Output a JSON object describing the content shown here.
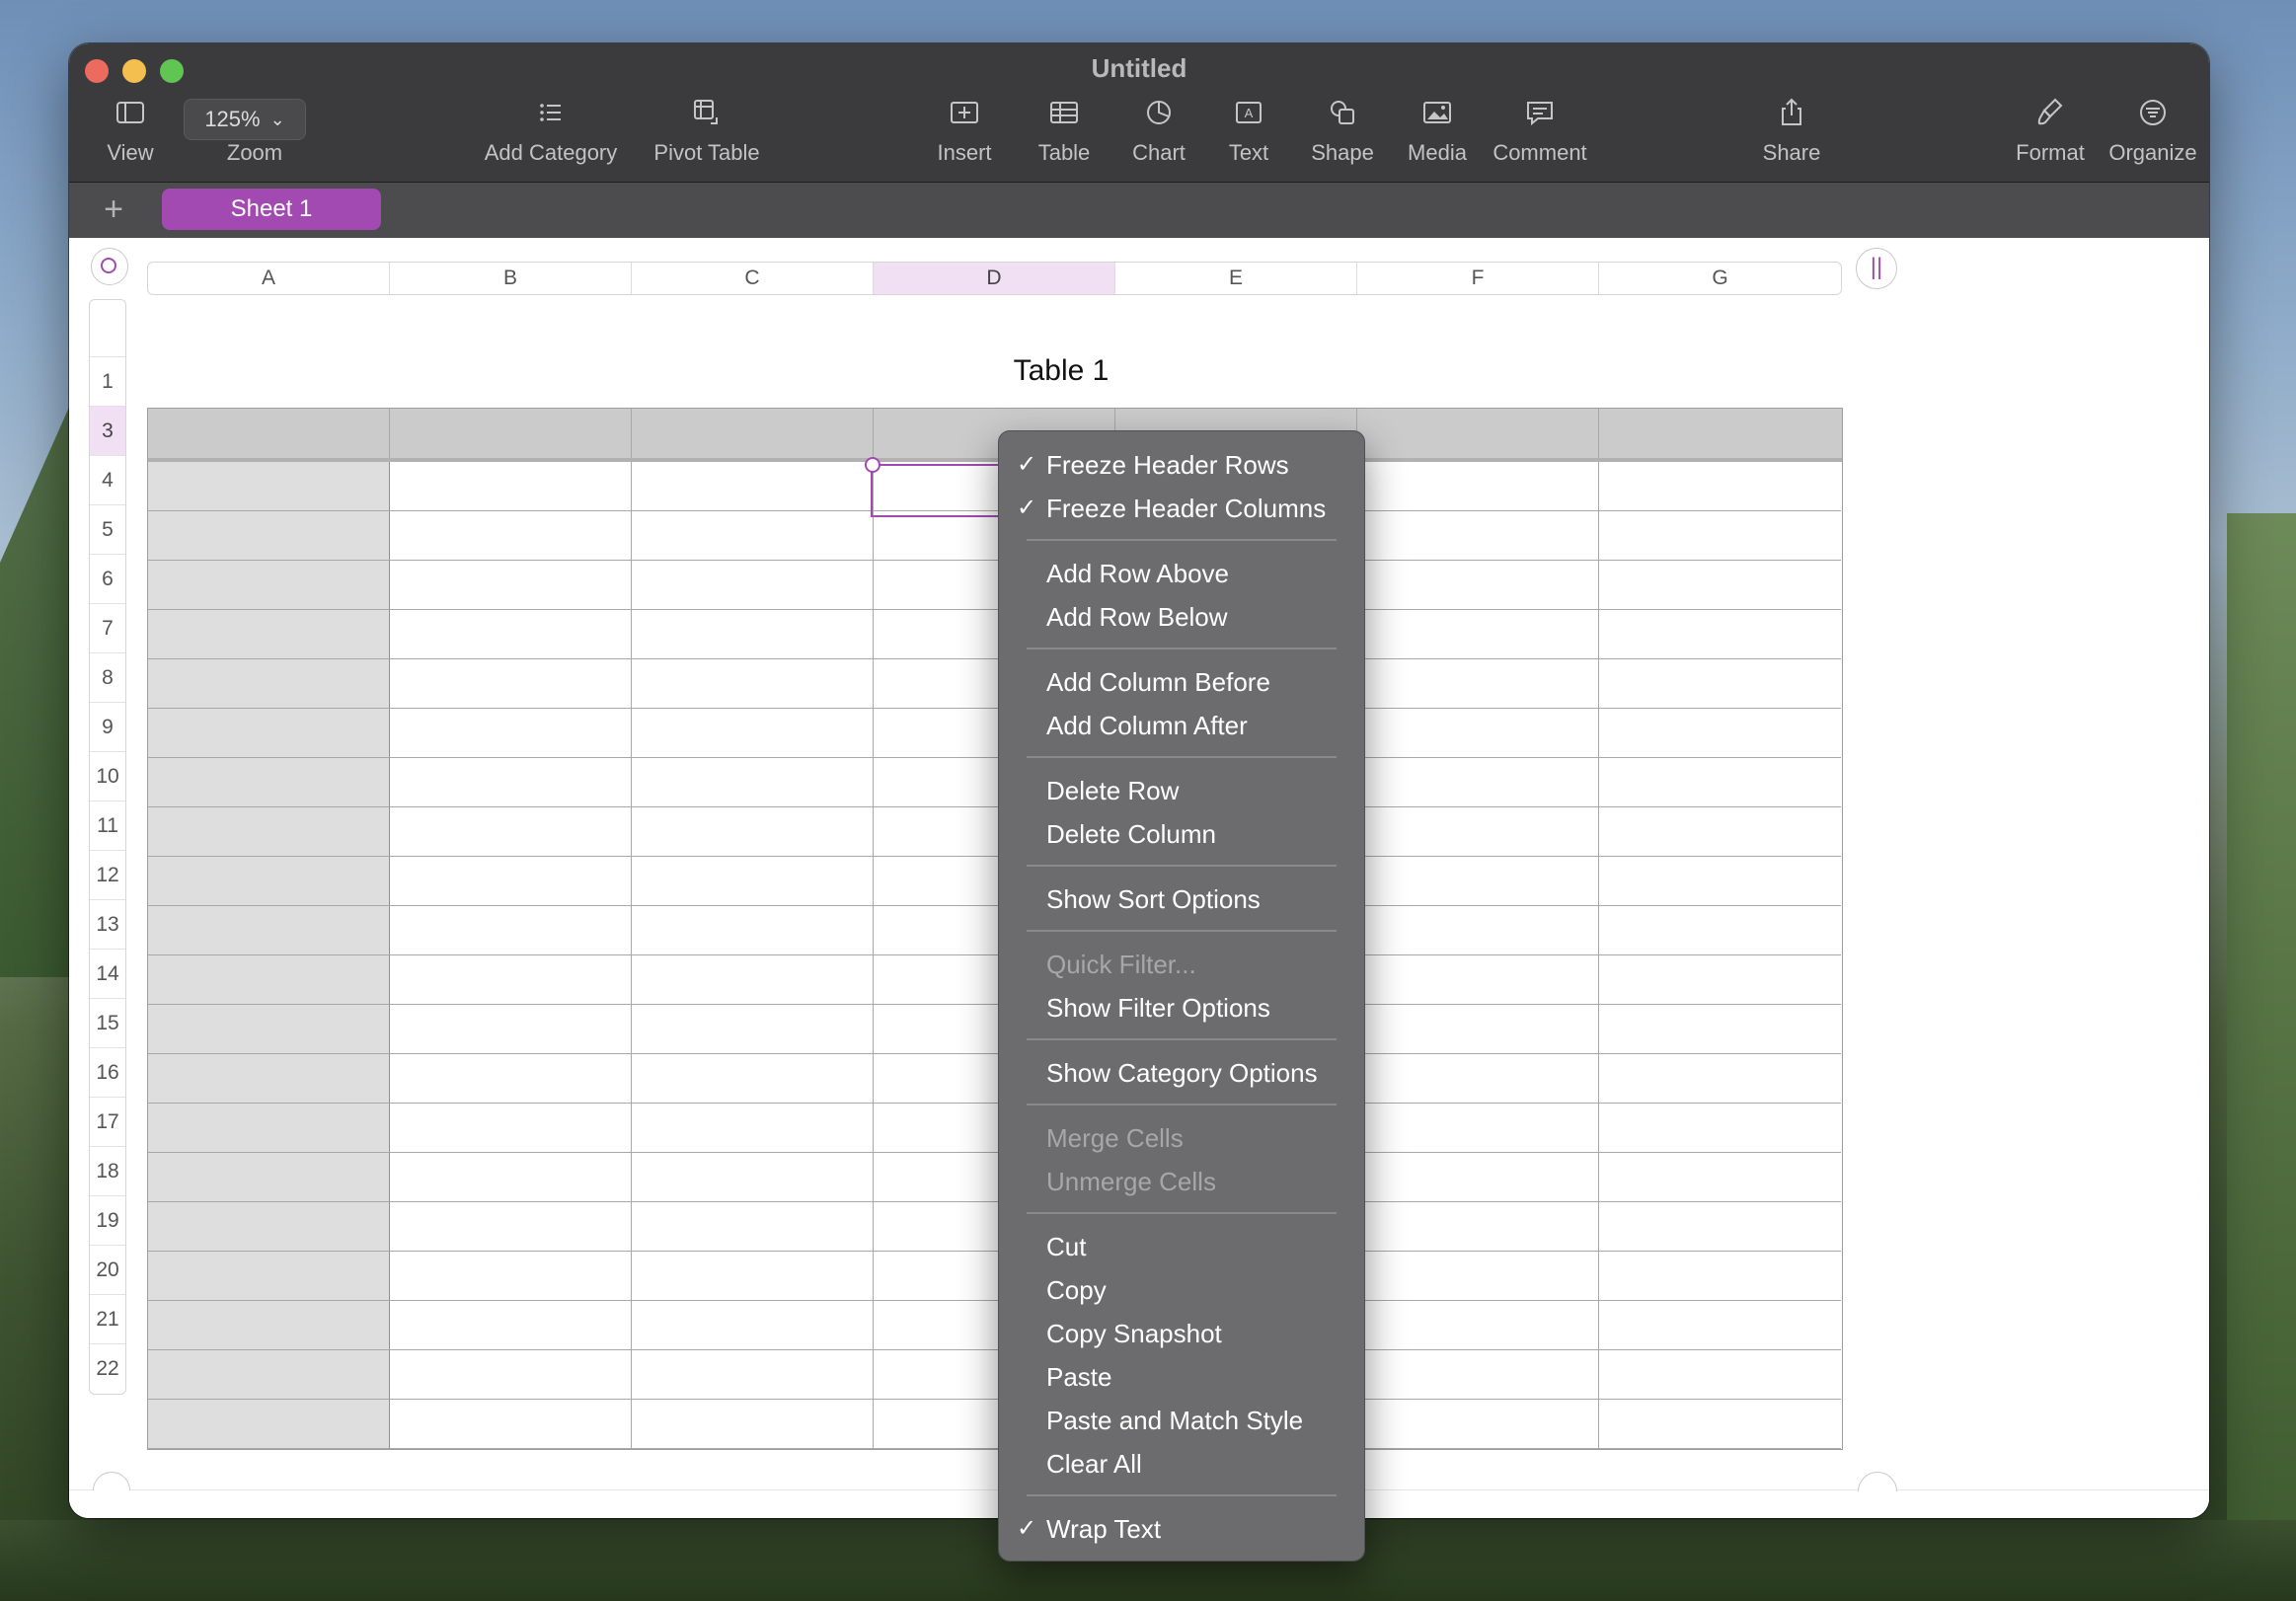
{
  "window": {
    "title": "Untitled"
  },
  "toolbar": {
    "view": "View",
    "zoom_value": "125%",
    "zoom": "Zoom",
    "add_category": "Add Category",
    "pivot_table": "Pivot Table",
    "insert": "Insert",
    "table": "Table",
    "chart": "Chart",
    "text": "Text",
    "shape": "Shape",
    "media": "Media",
    "comment": "Comment",
    "share": "Share",
    "format": "Format",
    "organize": "Organize"
  },
  "sheets": {
    "add": "+",
    "active": "Sheet 1"
  },
  "table": {
    "title": "Table 1",
    "columns": [
      "A",
      "B",
      "C",
      "D",
      "E",
      "F",
      "G"
    ],
    "selected_column": "D",
    "rows": [
      "",
      "1",
      "3",
      "4",
      "5",
      "6",
      "7",
      "8",
      "9",
      "10",
      "11",
      "12",
      "13",
      "14",
      "15",
      "16",
      "17",
      "18",
      "19",
      "20",
      "21",
      "22"
    ],
    "selected_row": "3"
  },
  "pause_icon": "||",
  "colors": {
    "accent": "#a24ab1",
    "toolbar": "#3b3b3d",
    "menu": "#6c6c6e"
  },
  "context_menu": {
    "check": "✓",
    "freeze_header_rows": "Freeze Header Rows",
    "freeze_header_columns": "Freeze Header Columns",
    "add_row_above": "Add Row Above",
    "add_row_below": "Add Row Below",
    "add_column_before": "Add Column Before",
    "add_column_after": "Add Column After",
    "delete_row": "Delete Row",
    "delete_column": "Delete Column",
    "show_sort_options": "Show Sort Options",
    "quick_filter": "Quick Filter...",
    "show_filter_options": "Show Filter Options",
    "show_category_options": "Show Category Options",
    "merge_cells": "Merge Cells",
    "unmerge_cells": "Unmerge Cells",
    "cut": "Cut",
    "copy": "Copy",
    "copy_snapshot": "Copy Snapshot",
    "paste": "Paste",
    "paste_and_match_style": "Paste and Match Style",
    "clear_all": "Clear All",
    "wrap_text": "Wrap Text"
  }
}
